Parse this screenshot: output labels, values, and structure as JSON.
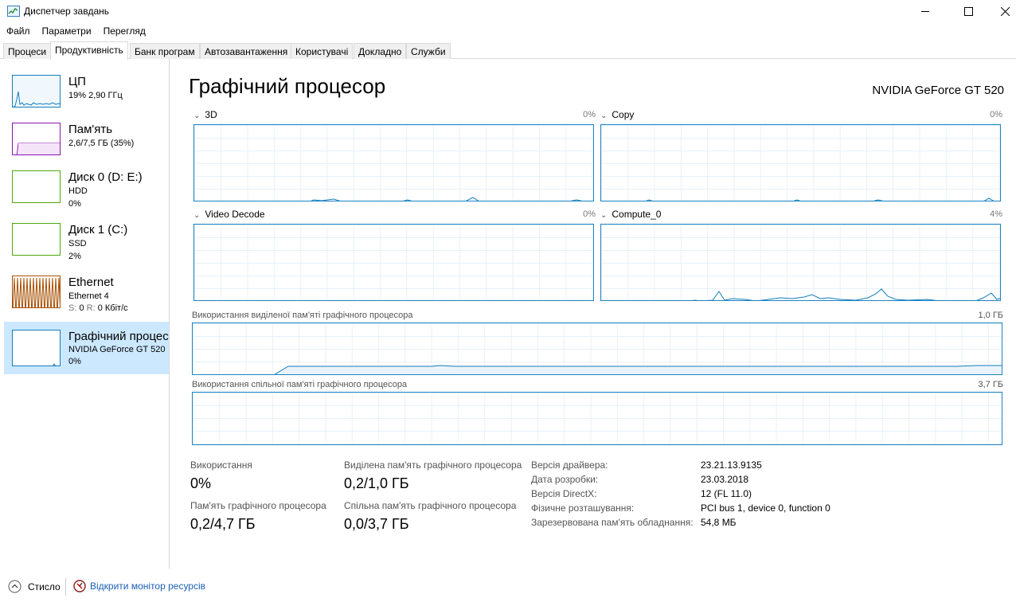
{
  "window": {
    "title": "Диспетчер завдань",
    "icon": "task-manager-icon"
  },
  "menu": [
    "Файл",
    "Параметри",
    "Перегляд"
  ],
  "tabs": [
    {
      "label": "Процеси"
    },
    {
      "label": "Продуктивність",
      "active": true
    },
    {
      "label": "Банк програм"
    },
    {
      "label": "Автозавантаження"
    },
    {
      "label": "Користувачі"
    },
    {
      "label": "Докладно"
    },
    {
      "label": "Служби"
    }
  ],
  "sidebar": {
    "items": [
      {
        "title": "ЦП",
        "line1": "19% 2,90 ГГц",
        "color": "#117dbb"
      },
      {
        "title": "Пам'ять",
        "line1": "2,6/7,5 ГБ (35%)",
        "color": "#8b12ae"
      },
      {
        "title": "Диск 0 (D: E:)",
        "line1": "HDD",
        "line2": "0%",
        "color": "#4da60c"
      },
      {
        "title": "Диск 1 (C:)",
        "line1": "SSD",
        "line2": "2%",
        "color": "#4da60c"
      },
      {
        "title": "Ethernet",
        "line1": "Ethernet 4",
        "line2_s": "S:",
        "line2_s_val": "0",
        "line2_r": "R:",
        "line2_r_val": "0 Кбіт/с",
        "color": "#a74f01"
      },
      {
        "title": "Графічний процесор",
        "line1": "NVIDIA GeForce GT 520",
        "line2": "0%",
        "color": "#117dbb",
        "selected": true
      }
    ]
  },
  "main": {
    "title": "Графічний процесор",
    "gpu_name": "NVIDIA GeForce GT 520",
    "graphs": [
      {
        "label": "3D",
        "percent": "0%"
      },
      {
        "label": "Copy",
        "percent": "0%"
      },
      {
        "label": "Video Decode",
        "percent": "0%"
      },
      {
        "label": "Compute_0",
        "percent": "4%"
      }
    ],
    "dedicated_mem": {
      "label": "Використання виділеної пам'яті графічного процесора",
      "max": "1,0 ГБ"
    },
    "shared_mem": {
      "label": "Використання спільної пам'яті графічного процесора",
      "max": "3,7 ГБ"
    }
  },
  "stats": {
    "usage_label": "Використання",
    "usage_value": "0%",
    "dedicated_label": "Виділена пам'ять графічного процесора",
    "dedicated_value": "0,2/1,0 ГБ",
    "gpu_mem_label": "Пам'ять графічного процесора",
    "gpu_mem_value": "0,2/4,7 ГБ",
    "shared_label": "Спільна пам'ять графічного процесора",
    "shared_value": "0,0/3,7 ГБ"
  },
  "info": [
    {
      "label": "Версія драйвера:",
      "value": "23.21.13.9135"
    },
    {
      "label": "Дата розробки:",
      "value": "23.03.2018"
    },
    {
      "label": "Версія DirectX:",
      "value": "12 (FL 11.0)"
    },
    {
      "label": "Фізичне розташування:",
      "value": "PCI bus 1, device 0, function 0"
    },
    {
      "label": "Зарезервована пам'ять обладнання:",
      "value": "54,8 МБ"
    }
  ],
  "bottom": {
    "fewer_details": "Стисло",
    "open_monitor": "Відкрити монітор ресурсів"
  }
}
